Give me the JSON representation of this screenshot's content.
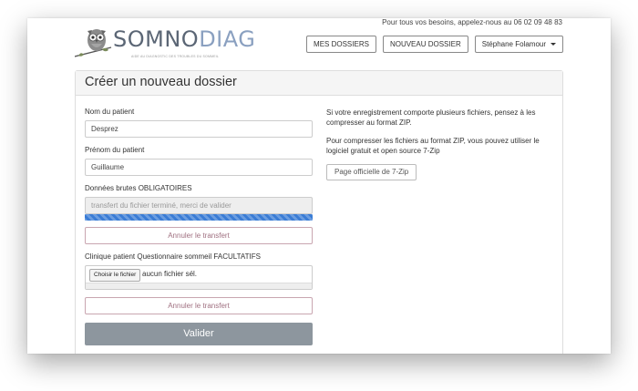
{
  "header": {
    "phone_text": "Pour tous vos besoins, appelez-nous au 06 02 09 48 83",
    "logo": {
      "name_part1": "SOMNO",
      "name_part2": "DIAG",
      "tagline": "AIDE AU DIAGNOSTIC DES TROUBLES DU SOMMEIL"
    },
    "nav": {
      "dossiers_label": "MES DOSSIERS",
      "new_label": "NOUVEAU DOSSIER",
      "user_label": "Stéphane Folamour"
    }
  },
  "panel": {
    "title": "Créer un nouveau dossier"
  },
  "form": {
    "lastname_label": "Nom du patient",
    "lastname_value": "Desprez",
    "firstname_label": "Prénom du patient",
    "firstname_value": "Guillaume",
    "raw_label": "Données brutes OBLIGATOIRES",
    "raw_status": "transfert du fichier terminé, merci de valider",
    "raw_progress": 1.0,
    "cancel_label_1": "Annuler le transfert",
    "optional_label": "Clinique patient Questionnaire sommeil FACULTATIFS",
    "choose_label": "Choisir le fichier",
    "no_file_label": "aucun fichier sél.",
    "cancel_label_2": "Annuler le transfert",
    "submit_label": "Valider"
  },
  "info": {
    "para1": "Si votre enregistrement comporte plusieurs fichiers, pensez à les compresser au format ZIP.",
    "para2": "Pour compresser les fichiers au format ZIP, vous pouvez utiliser le logiciel gratuit et open source 7-Zip",
    "zip_button": "Page officielle de 7-Zip"
  },
  "colors": {
    "progress": "#3a7cd5",
    "submit": "#8d969e",
    "cancel_border": "#c9a6b0"
  }
}
